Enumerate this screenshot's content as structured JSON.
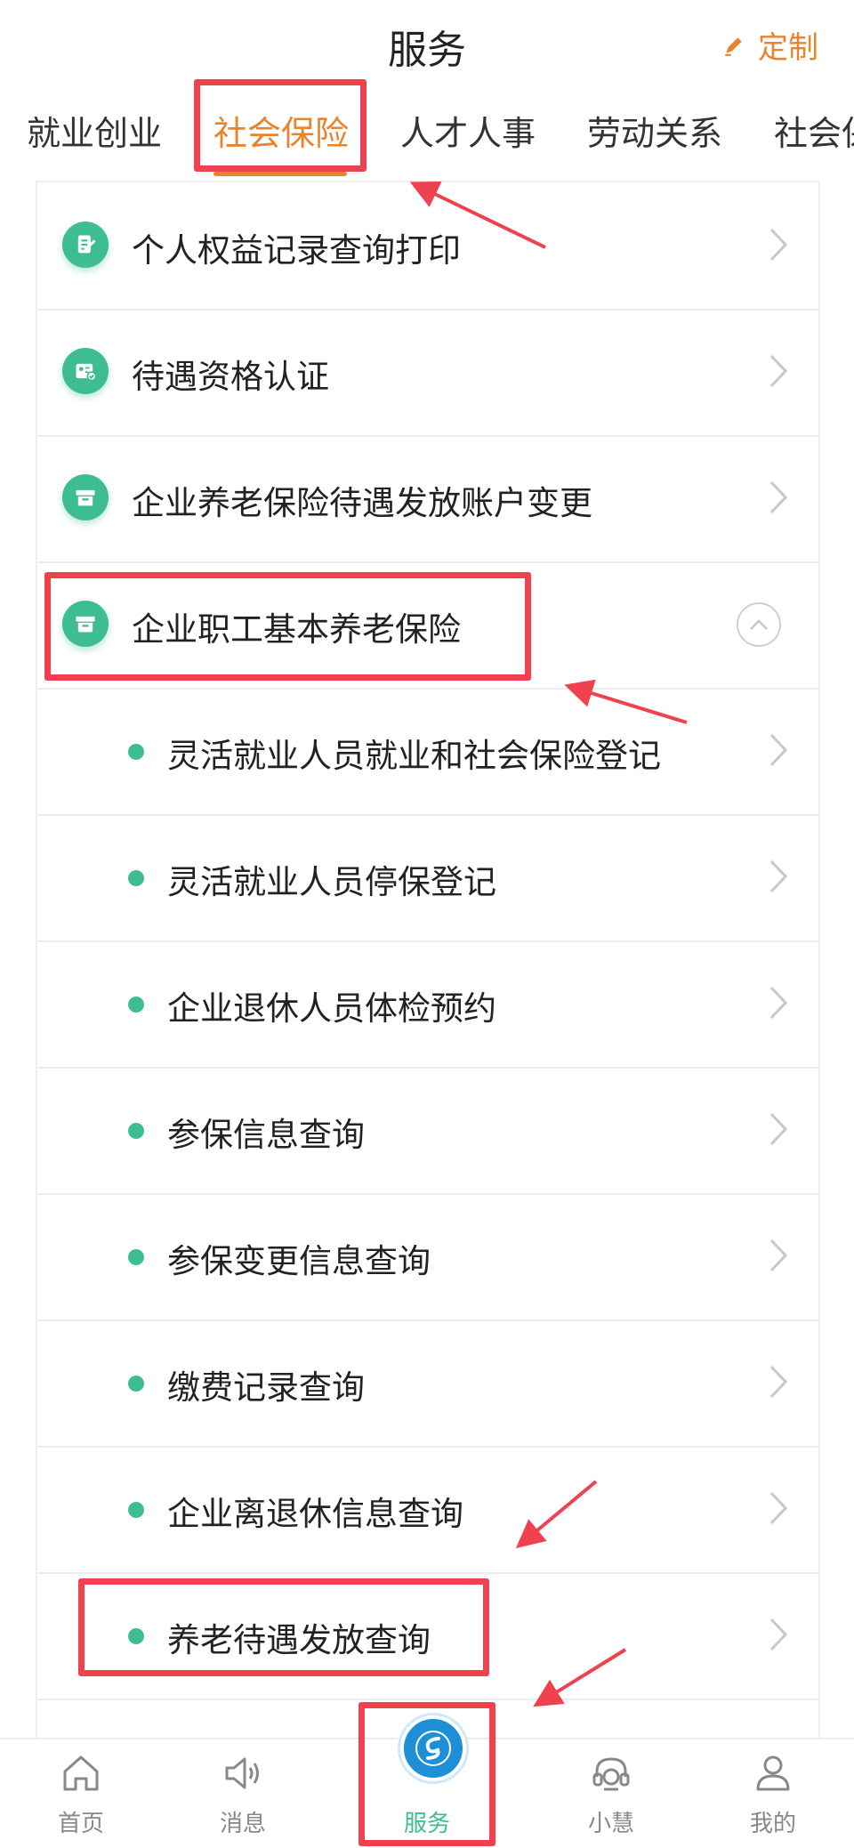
{
  "header": {
    "title": "服务",
    "customize_label": "定制"
  },
  "tabs": [
    "就业创业",
    "社会保险",
    "人才人事",
    "劳动关系",
    "社会保"
  ],
  "active_tab": "社会保险",
  "list": {
    "items": [
      {
        "label": "个人权益记录查询打印",
        "icon": "document-icon"
      },
      {
        "label": "待遇资格认证",
        "icon": "id-card-check-icon"
      },
      {
        "label": "企业养老保险待遇发放账户变更",
        "icon": "box-icon"
      },
      {
        "label": "企业职工基本养老保险",
        "icon": "box-icon",
        "expanded": true
      }
    ],
    "subitems": [
      {
        "label": "灵活就业人员就业和社会保险登记"
      },
      {
        "label": "灵活就业人员停保登记"
      },
      {
        "label": "企业退休人员体检预约"
      },
      {
        "label": "参保信息查询"
      },
      {
        "label": "参保变更信息查询"
      },
      {
        "label": "缴费记录查询"
      },
      {
        "label": "企业离退休信息查询"
      },
      {
        "label": "养老待遇发放查询"
      }
    ]
  },
  "bottom_nav": [
    {
      "label": "首页",
      "icon": "home-icon"
    },
    {
      "label": "消息",
      "icon": "speaker-icon"
    },
    {
      "label": "服务",
      "icon": "service-logo-icon",
      "active": true
    },
    {
      "label": "小慧",
      "icon": "headset-icon"
    },
    {
      "label": "我的",
      "icon": "user-icon"
    }
  ],
  "colors": {
    "accent": "#E8842C",
    "green": "#3EBD92",
    "highlight": "#F0424E",
    "logo_blue": "#1E8FD6"
  }
}
